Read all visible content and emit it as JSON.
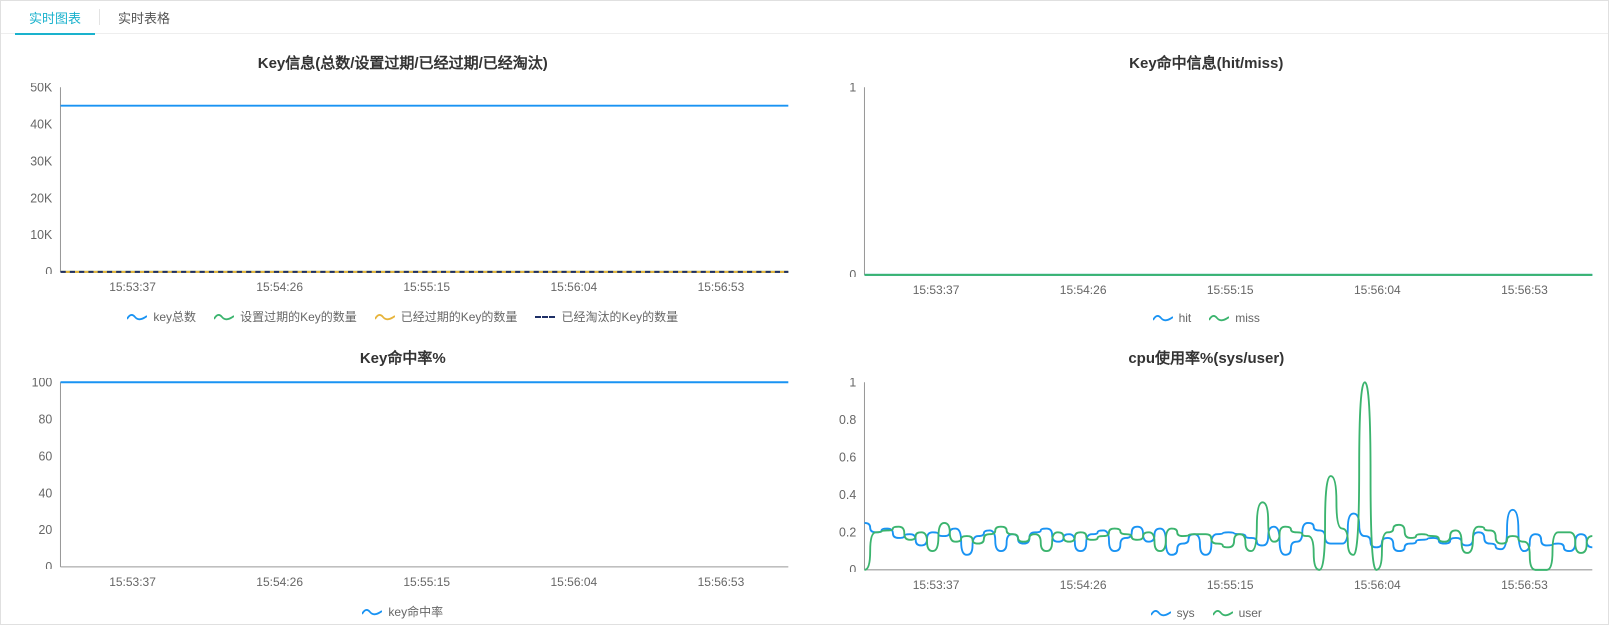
{
  "tabs": {
    "active": "实时图表",
    "other": "实时表格"
  },
  "x_ticks": [
    "15:53:37",
    "15:54:26",
    "15:55:15",
    "15:56:04",
    "15:56:53"
  ],
  "colors": {
    "key_total": "#1993F3",
    "key_expire_set": "#3BB46E",
    "key_expired": "#E7B43B",
    "key_evicted": "#1E2F66",
    "hit": "#1993F3",
    "miss": "#3BB46E",
    "hitrate": "#1993F3",
    "sys": "#1993F3",
    "user": "#3BB46E",
    "active_tab": "#1AB2CD"
  },
  "chart_data": [
    {
      "id": "key_info",
      "type": "line",
      "title": "Key信息(总数/设置过期/已经过期/已经淘汰)",
      "xlabel": "",
      "ylabel": "",
      "yticks": [
        0,
        10000,
        20000,
        30000,
        40000,
        50000
      ],
      "ytick_labels": [
        "0",
        "10K",
        "20K",
        "30K",
        "40K",
        "50K"
      ],
      "ylim": [
        0,
        50000
      ],
      "x": [
        "15:53:37",
        "15:54:26",
        "15:55:15",
        "15:56:04",
        "15:56:53"
      ],
      "series": [
        {
          "name": "key总数",
          "color": "#1993F3",
          "values": [
            45000,
            45000,
            45000,
            45000,
            45000
          ]
        },
        {
          "name": "设置过期的Key的数量",
          "color": "#3BB46E",
          "values": [
            0,
            0,
            0,
            0,
            0
          ]
        },
        {
          "name": "已经过期的Key的数量",
          "color": "#E7B43B",
          "values": [
            0,
            0,
            0,
            0,
            0
          ]
        },
        {
          "name": "已经淘汰的Key的数量",
          "color": "#1E2F66",
          "values": [
            0,
            0,
            0,
            0,
            0
          ]
        }
      ]
    },
    {
      "id": "key_hit",
      "type": "line",
      "title": "Key命中信息(hit/miss)",
      "xlabel": "",
      "ylabel": "",
      "yticks": [
        0,
        1
      ],
      "ytick_labels": [
        "0",
        "1"
      ],
      "ylim": [
        0,
        1
      ],
      "x": [
        "15:53:37",
        "15:54:26",
        "15:55:15",
        "15:56:04",
        "15:56:53"
      ],
      "series": [
        {
          "name": "hit",
          "color": "#1993F3",
          "values": [
            0,
            0,
            0,
            0,
            0
          ]
        },
        {
          "name": "miss",
          "color": "#3BB46E",
          "values": [
            0,
            0,
            0,
            0,
            0
          ]
        }
      ]
    },
    {
      "id": "hitrate",
      "type": "line",
      "title": "Key命中率%",
      "xlabel": "",
      "ylabel": "",
      "yticks": [
        0,
        20,
        40,
        60,
        80,
        100
      ],
      "ytick_labels": [
        "0",
        "20",
        "40",
        "60",
        "80",
        "100"
      ],
      "ylim": [
        0,
        100
      ],
      "x": [
        "15:53:37",
        "15:54:26",
        "15:55:15",
        "15:56:04",
        "15:56:53"
      ],
      "series": [
        {
          "name": "key命中率",
          "color": "#1993F3",
          "values": [
            100,
            100,
            100,
            100,
            100
          ]
        }
      ]
    },
    {
      "id": "cpu",
      "type": "line",
      "title": "cpu使用率%(sys/user)",
      "xlabel": "",
      "ylabel": "",
      "yticks": [
        0,
        0.2,
        0.4,
        0.6,
        0.8,
        1
      ],
      "ytick_labels": [
        "0",
        "0.2",
        "0.4",
        "0.6",
        "0.8",
        "1"
      ],
      "ylim": [
        0,
        1
      ],
      "x": [
        "15:53:37",
        "15:54:26",
        "15:55:15",
        "15:56:04",
        "15:56:53"
      ],
      "series": [
        {
          "name": "sys",
          "color": "#1993F3",
          "values": [
            0.25,
            0.2,
            0.22,
            0.17,
            0.19,
            0.13,
            0.2,
            0.18,
            0.22,
            0.08,
            0.18,
            0.21,
            0.1,
            0.19,
            0.14,
            0.2,
            0.22,
            0.15,
            0.19,
            0.1,
            0.19,
            0.21,
            0.1,
            0.17,
            0.23,
            0.15,
            0.22,
            0.08,
            0.14,
            0.19,
            0.08,
            0.19,
            0.2,
            0.19,
            0.17,
            0.13,
            0.23,
            0.08,
            0.15,
            0.25,
            0.21,
            0.14,
            0.14,
            0.3,
            0.18,
            0.12,
            0.17,
            0.1,
            0.14,
            0.16,
            0.17,
            0.14,
            0.17,
            0.13,
            0.2,
            0.14,
            0.11,
            0.32,
            0.1,
            0.19,
            0.13,
            0.14,
            0.1,
            0.19,
            0.12
          ]
        },
        {
          "name": "user",
          "color": "#3BB46E",
          "values": [
            0.0,
            0.2,
            0.21,
            0.23,
            0.16,
            0.2,
            0.1,
            0.25,
            0.15,
            0.18,
            0.14,
            0.19,
            0.23,
            0.19,
            0.15,
            0.19,
            0.1,
            0.2,
            0.15,
            0.2,
            0.16,
            0.18,
            0.22,
            0.19,
            0.16,
            0.2,
            0.1,
            0.22,
            0.18,
            0.19,
            0.19,
            0.14,
            0.12,
            0.19,
            0.1,
            0.36,
            0.15,
            0.23,
            0.2,
            0.18,
            0.0,
            0.5,
            0.22,
            0.08,
            1.0,
            0.0,
            0.2,
            0.24,
            0.17,
            0.19,
            0.18,
            0.15,
            0.21,
            0.09,
            0.23,
            0.21,
            0.14,
            0.18,
            0.15,
            0.0,
            0.0,
            0.2,
            0.2,
            0.09,
            0.18
          ]
        }
      ]
    }
  ]
}
